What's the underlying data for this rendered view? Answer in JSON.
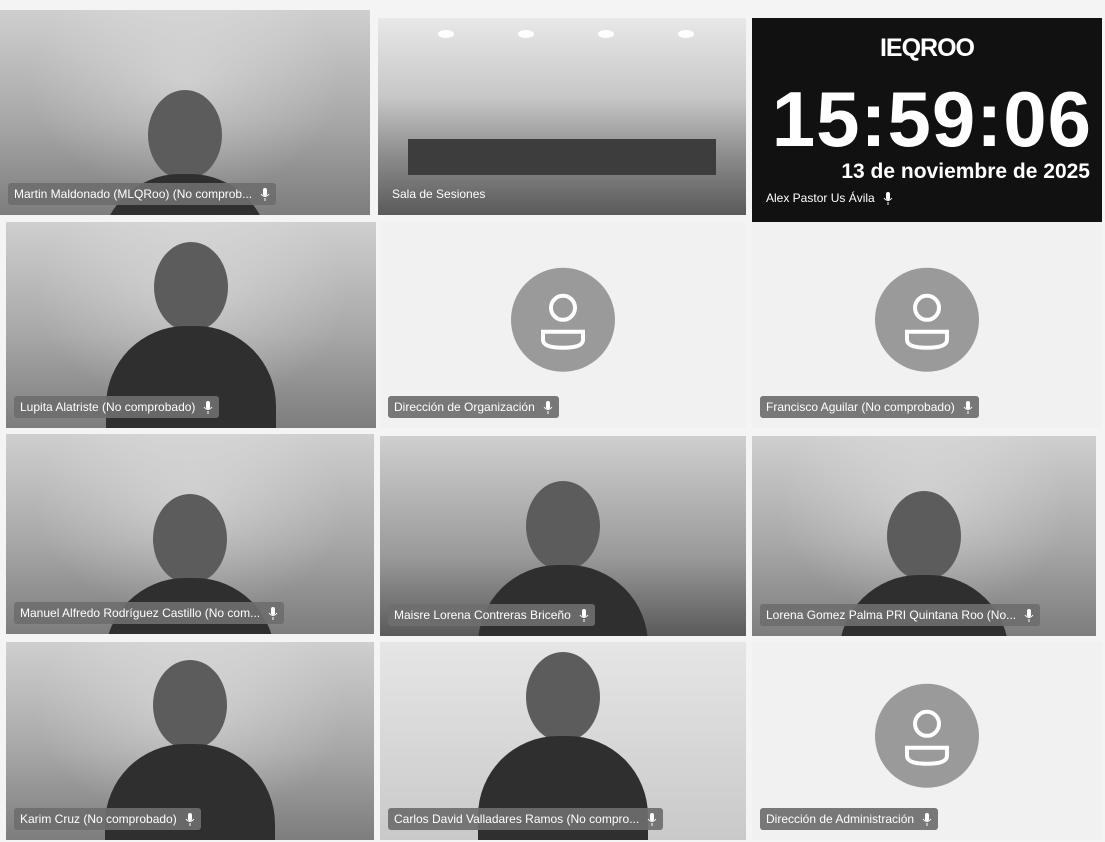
{
  "clock": {
    "brand": "IEQROO",
    "time": "15:59:06",
    "date": "13 de noviembre de 2025",
    "participant": "Alex Pastor Us Ávila"
  },
  "participants": [
    {
      "name": "Martin Maldonado (MLQRoo) (No comprob...",
      "mic": "mic-icon"
    },
    {
      "name": "Sala de Sesiones",
      "mic": ""
    },
    {
      "name": "Lupita Alatriste (No comprobado)",
      "mic": "mic-icon"
    },
    {
      "name": "Dirección de Organización",
      "mic": "mic-icon"
    },
    {
      "name": "Francisco Aguilar (No comprobado)",
      "mic": "mic-icon"
    },
    {
      "name": "Manuel Alfredo Rodríguez Castillo (No com...",
      "mic": "mic-icon"
    },
    {
      "name": "Maisre Lorena Contreras Briceño",
      "mic": "mic-icon"
    },
    {
      "name": "Lorena Gomez Palma PRI Quintana Roo (No...",
      "mic": "mic-icon"
    },
    {
      "name": "Karim Cruz (No comprobado)",
      "mic": "mic-icon"
    },
    {
      "name": "Carlos David Valladares Ramos (No compro...",
      "mic": "mic-icon"
    },
    {
      "name": "Dirección de Administración",
      "mic": "mic-icon"
    }
  ],
  "colors": {
    "clock_bg": "#111111",
    "namebar_bg": "#6e6e6e",
    "avatar_bg": "#9a9a9a"
  }
}
